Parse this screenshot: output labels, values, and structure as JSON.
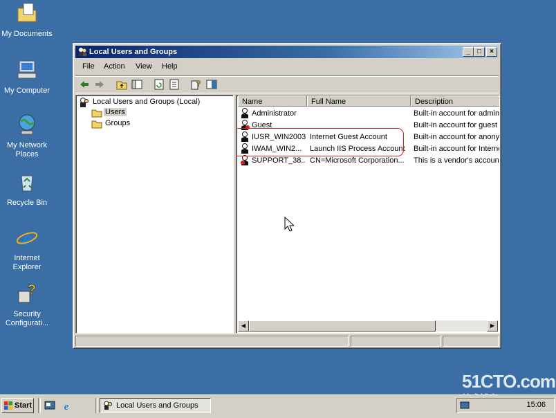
{
  "desktop": {
    "icons": [
      {
        "label": "My Documents"
      },
      {
        "label": "My Computer"
      },
      {
        "label": "My Network Places"
      },
      {
        "label": "Recycle Bin"
      },
      {
        "label": "Internet Explorer"
      },
      {
        "label": "Security Configurati..."
      }
    ]
  },
  "window": {
    "title": "Local Users and Groups",
    "controls": {
      "minimize": "_",
      "maximize": "□",
      "close": "×"
    },
    "menu": [
      "File",
      "Action",
      "View",
      "Help"
    ],
    "tree": {
      "root": "Local Users and Groups (Local)",
      "children": [
        "Users",
        "Groups"
      ],
      "selected": "Users"
    },
    "list": {
      "columns": [
        "Name",
        "Full Name",
        "Description"
      ],
      "rows": [
        {
          "name": "Administrator",
          "full_name": "",
          "description": "Built-in account for admini"
        },
        {
          "name": "Guest",
          "full_name": "",
          "description": "Built-in account for guest a"
        },
        {
          "name": "IUSR_WIN2003",
          "full_name": "Internet Guest Account",
          "description": "Built-in account for anonyr"
        },
        {
          "name": "IWAM_WIN2...",
          "full_name": "Launch IIS Process Account",
          "description": "Built-in account for Interne"
        },
        {
          "name": "SUPPORT_38...",
          "full_name": "CN=Microsoft Corporation...",
          "description": "This is a vendor's account"
        }
      ]
    }
  },
  "taskbar": {
    "start_label": "Start",
    "task_label": "Local Users and Groups",
    "clock": "15:06"
  },
  "watermark": {
    "text": "51CTO.com",
    "sub": "技术博客  Blog"
  },
  "colors": {
    "desktop": "#3a6ea5",
    "title_start": "#0a246a",
    "highlight_ring": "#e02020"
  }
}
